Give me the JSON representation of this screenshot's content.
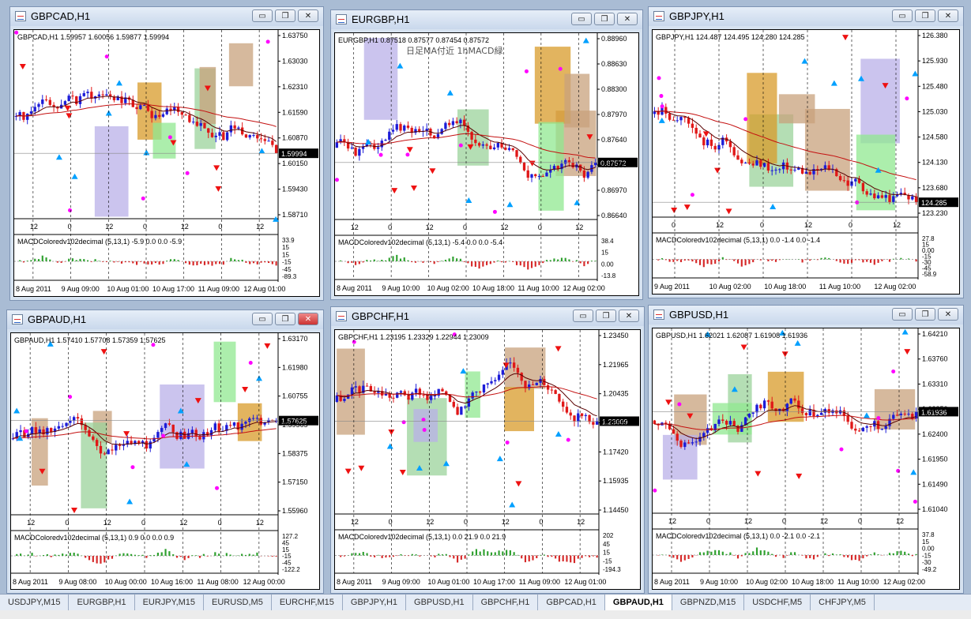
{
  "windows": [
    {
      "id": "gbpcad",
      "title": "GBPCAD,H1",
      "header": "GBPCAD,H1  1.59957 1.60056 1.59877 1.59994",
      "note": "",
      "prices": [
        "1.63750",
        "1.63030",
        "1.62310",
        "1.61590",
        "1.60870",
        "1.60150",
        "1.59430",
        "1.58710"
      ],
      "current": "1.59994",
      "xhours": [
        "12",
        "0",
        "12",
        "0",
        "12",
        "0",
        "12"
      ],
      "macd_label": "MACDColoredv102decimal (5,13,1) -5.9 0.0 0.0 -5.9",
      "macd_scale": [
        "33.9",
        "15",
        "15",
        "-15",
        "-45",
        "-89.3"
      ],
      "dates": [
        "8 Aug 2011",
        "9 Aug 09:00",
        "10 Aug 01:00",
        "10 Aug 17:00",
        "11 Aug 09:00",
        "12 Aug 01:00"
      ],
      "seed": 11,
      "active": false
    },
    {
      "id": "eurgbp",
      "title": "EURGBP,H1",
      "header": "EURGBP,H1  0.87518 0.87577 0.87454 0.87572",
      "note": "日足MA付近  1hMACD緑",
      "prices": [
        "0.88960",
        "0.88630",
        "0.88300",
        "0.87970",
        "0.87640",
        "0.87300",
        "0.86970",
        "0.86640"
      ],
      "current": "0.87572",
      "xhours": [
        "12",
        "0",
        "12",
        "0",
        "12",
        "0",
        "12"
      ],
      "macd_label": "MACDColoredv102decimal (5,13,1) -5.4 0.0 0.0 -5.4",
      "macd_scale": [
        "38.4",
        "15",
        "0.00",
        "-13.8"
      ],
      "dates": [
        "8 Aug 2011",
        "9 Aug 10:00",
        "10 Aug 02:00",
        "10 Aug 18:00",
        "11 Aug 10:00",
        "12 Aug 02:00"
      ],
      "seed": 23,
      "active": false
    },
    {
      "id": "gbpjpy",
      "title": "GBPJPY,H1",
      "header": "GBPJPY,H1  124.487 124.495 124.280 124.285",
      "note": "",
      "prices": [
        "126.380",
        "125.930",
        "125.480",
        "125.030",
        "124.580",
        "124.130",
        "123.680",
        "123.230"
      ],
      "current": "124.285",
      "xhours": [
        "0",
        "12",
        "0",
        "12",
        "0",
        "12"
      ],
      "macd_label": "MACDColoredv102decimal (5,13,1) 0.0 -1.4 0.0 -1.4",
      "macd_scale": [
        "27.8",
        "15",
        "0.00",
        "-15",
        "-30",
        "-45",
        "-58.9"
      ],
      "dates": [
        "9 Aug 2011",
        "10 Aug 02:00",
        "10 Aug 18:00",
        "11 Aug 10:00",
        "12 Aug 02:00"
      ],
      "seed": 37,
      "active": false
    },
    {
      "id": "gbpaud",
      "title": "GBPAUD,H1",
      "header": "GBPAUD,H1  1.57410 1.57708 1.57359 1.57625",
      "note": "",
      "prices": [
        "1.63170",
        "1.61980",
        "1.60755",
        "1.59565",
        "1.58375",
        "1.57150",
        "1.55960"
      ],
      "current": "1.57625",
      "xhours": [
        "12",
        "0",
        "12",
        "0",
        "12",
        "0",
        "12"
      ],
      "macd_label": "MACDColoredv102decimal (5,13,1) 0.9 0.0 0.0 0.9",
      "macd_scale": [
        "127.2",
        "45",
        "15",
        "-15",
        "-45",
        "-122.2"
      ],
      "dates": [
        "8 Aug 2011",
        "9 Aug 08:00",
        "10 Aug 00:00",
        "10 Aug 16:00",
        "11 Aug 08:00",
        "12 Aug 00:00"
      ],
      "seed": 51,
      "active": true
    },
    {
      "id": "gbpchf",
      "title": "GBPCHF,H1",
      "header": "GBPCHF,H1  1.23195 1.23329 1.22944 1.23009",
      "note": "",
      "prices": [
        "1.23450",
        "1.21965",
        "1.20435",
        "1.18950",
        "1.17420",
        "1.15935",
        "1.14450"
      ],
      "current": "1.23009",
      "xhours": [
        "12",
        "0",
        "12",
        "0",
        "12",
        "0",
        "12"
      ],
      "macd_label": "MACDColoredv102decimal (5,13,1) 0.0 21.9 0.0 21.9",
      "macd_scale": [
        "202",
        "45",
        "15",
        "-15",
        "-194.3"
      ],
      "dates": [
        "8 Aug 2011",
        "9 Aug 09:00",
        "10 Aug 01:00",
        "10 Aug 17:00",
        "11 Aug 09:00",
        "12 Aug 01:00"
      ],
      "seed": 67,
      "active": false
    },
    {
      "id": "gbpusd",
      "title": "GBPUSD,H1",
      "header": "GBPUSD,H1  1.62021 1.62087 1.61908 1.61936",
      "note": "",
      "prices": [
        "1.64210",
        "1.63760",
        "1.63310",
        "1.62850",
        "1.62400",
        "1.61950",
        "1.61490",
        "1.61040"
      ],
      "current": "1.61936",
      "xhours": [
        "12",
        "0",
        "12",
        "0",
        "12",
        "0",
        "12"
      ],
      "macd_label": "MACDColoredv102decimal (5,13,1) 0.0 -2.1 0.0 -2.1",
      "macd_scale": [
        "37.8",
        "15",
        "0.00",
        "-15",
        "-30",
        "-49.2"
      ],
      "dates": [
        "8 Aug 2011",
        "9 Aug 10:00",
        "10 Aug 02:00",
        "10 Aug 18:00",
        "11 Aug 10:00",
        "12 Aug 02:00"
      ],
      "seed": 83,
      "active": false
    }
  ],
  "taskbar": [
    "USDJPY,M15",
    "EURGBP,H1",
    "EURJPY,M15",
    "EURUSD,M5",
    "EURCHF,M15",
    "GBPJPY,H1",
    "GBPUSD,H1",
    "GBPCHF,H1",
    "GBPCAD,H1",
    "GBPAUD,H1",
    "GBPNZD,M15",
    "USDCHF,M5",
    "CHFJPY,M5"
  ],
  "taskbar_active": "GBPAUD,H1",
  "icons": {
    "minimize": "minimize-icon",
    "restore": "restore-icon",
    "close": "close-icon"
  },
  "colors": {
    "bull": "#1c1cd8",
    "bear": "#e01818",
    "ma": "#c41010",
    "maFast": "#5a0000",
    "pivot": "#00a0ff",
    "stop": "#ff00ff",
    "arrow": "#ee1111"
  }
}
